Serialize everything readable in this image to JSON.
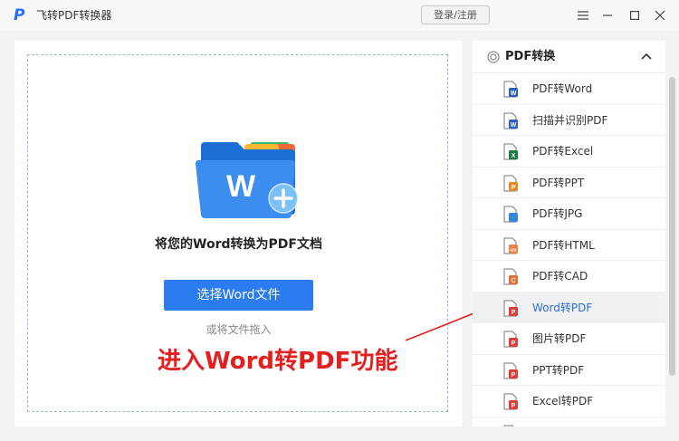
{
  "app": {
    "logo_letter": "P",
    "title": "飞转PDF转换器",
    "login_label": "登录/注册"
  },
  "window_controls": [
    "menu-icon",
    "minimize-icon",
    "maximize-icon",
    "close-icon"
  ],
  "drop_zone": {
    "title": "将您的Word转换为PDF文档",
    "choose_button": "选择Word文件",
    "drag_hint": "或将文件拖入"
  },
  "annotation": {
    "text": "进入Word转PDF功能",
    "color": "#e41f1f"
  },
  "sidebar": {
    "header_label": "PDF转换",
    "items": [
      {
        "label": "PDF转Word",
        "icon": "word-file-icon",
        "badge_color": "#2b5fbd",
        "badge_text": "W"
      },
      {
        "label": "扫描并识别PDF",
        "icon": "word-file-icon",
        "badge_color": "#2b5fbd",
        "badge_text": "W"
      },
      {
        "label": "PDF转Excel",
        "icon": "excel-file-icon",
        "badge_color": "#1e7c45",
        "badge_text": "X"
      },
      {
        "label": "PDF转PPT",
        "icon": "ppt-file-icon",
        "badge_color": "#e58a2c",
        "badge_text": "P"
      },
      {
        "label": "PDF转JPG",
        "icon": "image-file-icon",
        "badge_color": "#3a87d8",
        "badge_text": ""
      },
      {
        "label": "PDF转HTML",
        "icon": "html-file-icon",
        "badge_color": "#e8844a",
        "badge_text": "</>"
      },
      {
        "label": "PDF转CAD",
        "icon": "cad-file-icon",
        "badge_color": "#e0713a",
        "badge_text": "C"
      },
      {
        "label": "Word转PDF",
        "icon": "pdf-file-icon",
        "badge_color": "#d9403a",
        "badge_text": "P",
        "active": true
      },
      {
        "label": "图片转PDF",
        "icon": "pdf-file-icon",
        "badge_color": "#d9403a",
        "badge_text": "P"
      },
      {
        "label": "PPT转PDF",
        "icon": "pdf-file-icon",
        "badge_color": "#d9403a",
        "badge_text": "P"
      },
      {
        "label": "Excel转PDF",
        "icon": "pdf-file-icon",
        "badge_color": "#d9403a",
        "badge_text": "P"
      },
      {
        "label": "",
        "icon": "pdf-file-icon",
        "badge_color": "#d9403a",
        "badge_text": "P"
      }
    ]
  },
  "colors": {
    "accent": "#2b7cf0",
    "active_text": "#2b6fd6",
    "annotation_red": "#e41f1f"
  }
}
